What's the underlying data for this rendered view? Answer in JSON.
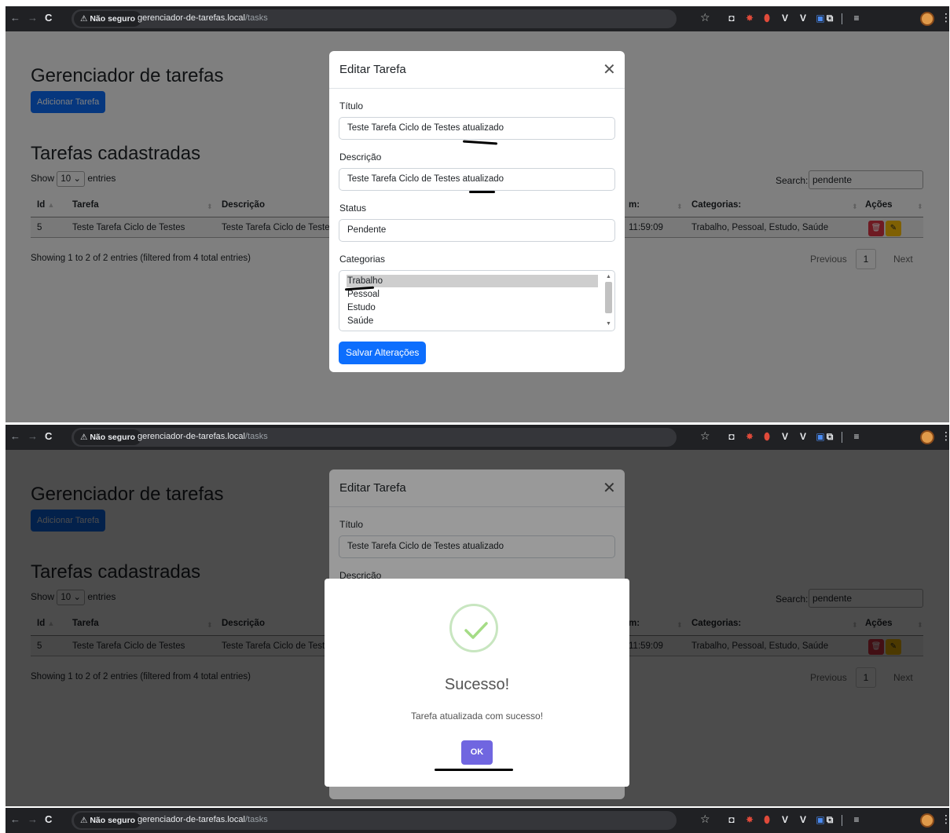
{
  "browser": {
    "security_chip": "⚠ Não seguro",
    "url_host": "gerenciador-de-tarefas.local",
    "url_path": "/tasks"
  },
  "page": {
    "title": "Gerenciador de tarefas",
    "add_button": "Adicionar Tarefa",
    "section_title": "Tarefas cadastradas",
    "show_label": "Show",
    "entries_value": "10",
    "entries_label": "entries",
    "search_label": "Search:",
    "search_value": "pendente",
    "table_headers": [
      "Id",
      "Tarefa",
      "Descrição",
      "m:",
      "Categorias:",
      "Ações"
    ],
    "rows": [
      {
        "id": "5",
        "tarefa": "Teste Tarefa Ciclo de Testes",
        "descricao": "Teste Tarefa Ciclo de Teste",
        "data": "11:59:09",
        "categorias": "Trabalho, Pessoal, Estudo, Saúde"
      }
    ],
    "info": "Showing 1 to 2 of 2 entries (filtered from 4 total entries)",
    "pagination": {
      "previous": "Previous",
      "current": "1",
      "next": "Next"
    }
  },
  "modal": {
    "title": "Editar Tarefa",
    "titulo_label": "Título",
    "titulo_value": "Teste Tarefa Ciclo de Testes atualizado",
    "descricao_label": "Descrição",
    "descricao_value": "Teste Tarefa Ciclo de Testes atualizado",
    "status_label": "Status",
    "status_value": "Pendente",
    "categorias_label": "Categorias",
    "categorias_options": [
      "Trabalho",
      "Pessoal",
      "Estudo",
      "Saúde"
    ],
    "save_button": "Salvar Alterações"
  },
  "success": {
    "title": "Sucesso!",
    "text": "Tarefa atualizada com sucesso!",
    "ok_button": "OK"
  },
  "colors": {
    "primary": "#0d6efd",
    "danger": "#dc3545",
    "warning": "#ffc107",
    "swal_confirm": "#7066e0",
    "success_ring": "#a5dc86"
  }
}
